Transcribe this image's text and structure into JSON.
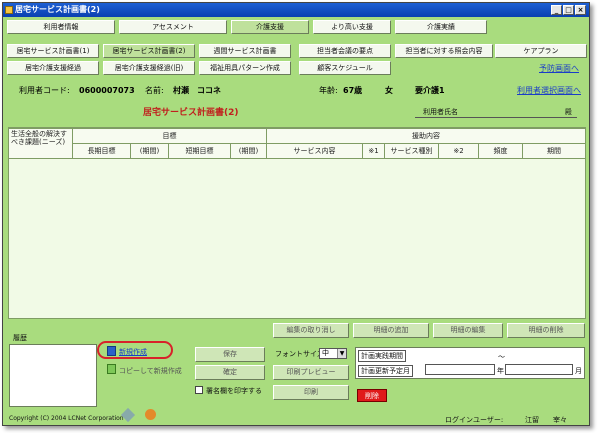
{
  "window": {
    "title": "居宅サービス計画書(2)",
    "minimize": "_",
    "maximize": "□",
    "close": "×"
  },
  "nav_row1": [
    {
      "label": "利用者情報"
    },
    {
      "label": "アセスメント"
    },
    {
      "label": "介護支援"
    },
    {
      "label": "より高い支援"
    },
    {
      "label": "介護実績"
    }
  ],
  "nav_row2": [
    {
      "label": "居宅サービス計画書(1)"
    },
    {
      "label": "居宅サービス計画書(2)"
    },
    {
      "label": "週間サービス計画書"
    },
    {
      "label": "担当者会議の要点"
    },
    {
      "label": "担当者に対する照会内容"
    },
    {
      "label": "ケアプラン"
    }
  ],
  "nav_row3": [
    {
      "label": "居宅介護支援経過"
    },
    {
      "label": "居宅介護支援経過(旧)"
    },
    {
      "label": "福祉用具パターン作成"
    },
    {
      "label": "顧客スケジュール"
    }
  ],
  "yobo_link": "予防画面へ",
  "user_info": {
    "code_label": "利用者コード:",
    "code": "0600007073",
    "name_label": "名前:",
    "name": "村瀬　ココネ",
    "age_label": "年齢:",
    "age": "67歳",
    "gender": "女",
    "care_level": "要介護1",
    "select_link": "利用者選択画面へ"
  },
  "form": {
    "heading": "居宅サービス計画書(2)",
    "user_name_label": "利用者氏名",
    "honorific": "殿"
  },
  "table": {
    "col_needs": "生活全般の解決すべき課題(ニーズ)",
    "group_goal": "目標",
    "group_support": "援助内容",
    "columns": [
      "長期目標",
      "(期間)",
      "短期目標",
      "(期間)",
      "サービス内容",
      "※1",
      "サービス種別",
      "※2",
      "頻度",
      "期間"
    ]
  },
  "detail_buttons": [
    "編集の取り消し",
    "明細の追加",
    "明細の編集",
    "明細の削除"
  ],
  "history_label": "履歴",
  "actions": {
    "new": "新規作成",
    "copy_new": "コピーして新規作成",
    "save": "保存",
    "confirm": "確定",
    "print_signature": "署名欄を印字する",
    "font_size_label": "フォントサイズ",
    "font_size_value": "中",
    "print_preview": "印刷プレビュー",
    "print": "印刷",
    "delete": "削除"
  },
  "period": {
    "label": "計画実践期間",
    "tilde": "～",
    "renew_label": "計画更新予定月",
    "year": "年",
    "month": "月"
  },
  "footer": {
    "copyright": "Copyright (C) 2004 LCNet Corporation",
    "login_label": "ログインユーザー:",
    "login_user": "江留　　宰々"
  },
  "colors": {
    "bg": "#a9dc7e",
    "title": "#1d5fd3",
    "heading": "#c0201e",
    "delete": "#e01b1b",
    "link": "#1a3cc8"
  }
}
